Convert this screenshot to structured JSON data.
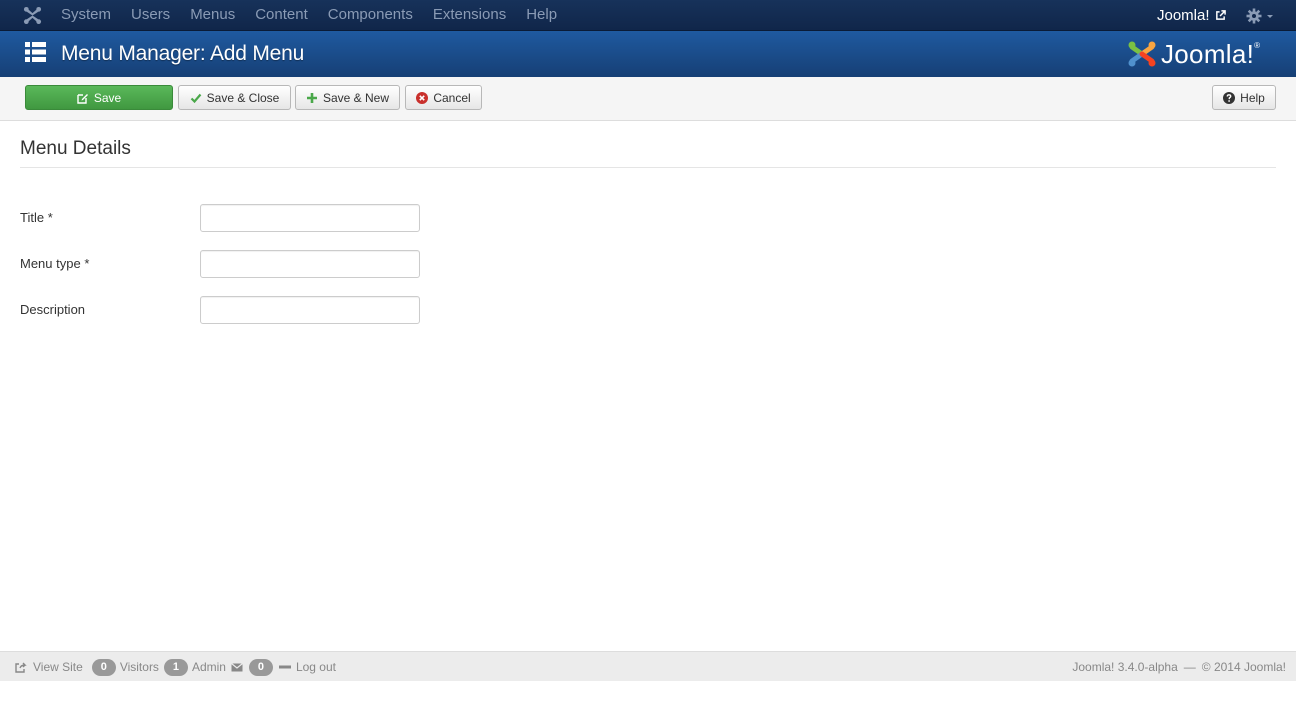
{
  "navbar": {
    "menu": [
      {
        "label": "System"
      },
      {
        "label": "Users"
      },
      {
        "label": "Menus"
      },
      {
        "label": "Content"
      },
      {
        "label": "Components"
      },
      {
        "label": "Extensions"
      },
      {
        "label": "Help"
      }
    ],
    "site_link": "Joomla!",
    "site_link_icon": "external-link-icon",
    "settings_icon": "gear-icon"
  },
  "header": {
    "title": "Menu Manager: Add Menu",
    "icon": "list-icon",
    "brand": "Joomla!"
  },
  "toolbar": {
    "save_label": "Save",
    "save_close_label": "Save & Close",
    "save_new_label": "Save & New",
    "cancel_label": "Cancel",
    "help_label": "Help"
  },
  "form": {
    "section_title": "Menu Details",
    "fields": [
      {
        "label": "Title *",
        "value": ""
      },
      {
        "label": "Menu type *",
        "value": ""
      },
      {
        "label": "Description",
        "value": ""
      }
    ]
  },
  "status": {
    "view_site": "View Site",
    "visitors_count": "0",
    "visitors_label": "Visitors",
    "admin_count": "1",
    "admin_label": "Admin",
    "messages_count": "0",
    "logout_label": "Log out",
    "version": "Joomla! 3.4.0-alpha",
    "separator": "—",
    "copyright": "© 2014 Joomla!"
  },
  "colors": {
    "navbar_bg": "#10264a",
    "header_bg": "#1f5aa0",
    "save_button": "#4aa84a",
    "cancel_icon": "#c9302c",
    "check_icon": "#4aa84a"
  }
}
